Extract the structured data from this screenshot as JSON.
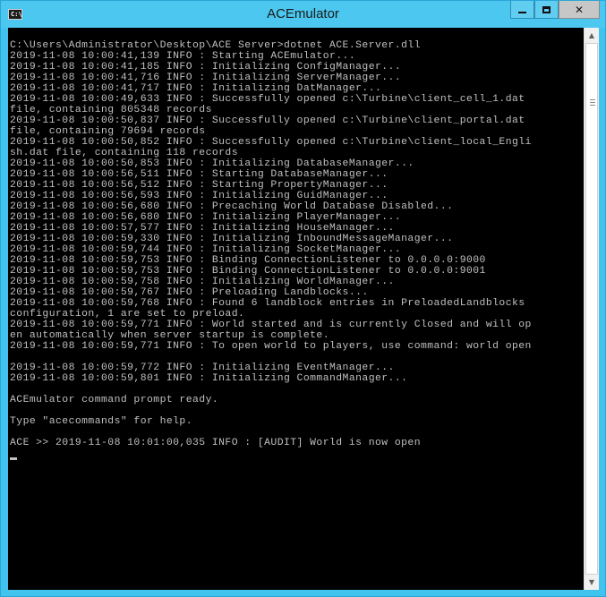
{
  "window": {
    "title": "ACEmulator",
    "minimize_glyph": "minimize-icon",
    "maximize_glyph": "maximize-icon",
    "close_glyph": "✕"
  },
  "console": {
    "lines": [
      "C:\\Users\\Administrator\\Desktop\\ACE Server>dotnet ACE.Server.dll",
      "2019-11-08 10:00:41,139 INFO : Starting ACEmulator...",
      "2019-11-08 10:00:41,185 INFO : Initializing ConfigManager...",
      "2019-11-08 10:00:41,716 INFO : Initializing ServerManager...",
      "2019-11-08 10:00:41,717 INFO : Initializing DatManager...",
      "2019-11-08 10:00:49,633 INFO : Successfully opened c:\\Turbine\\client_cell_1.dat",
      "file, containing 805348 records",
      "2019-11-08 10:00:50,837 INFO : Successfully opened c:\\Turbine\\client_portal.dat",
      "file, containing 79694 records",
      "2019-11-08 10:00:50,852 INFO : Successfully opened c:\\Turbine\\client_local_Engli",
      "sh.dat file, containing 118 records",
      "2019-11-08 10:00:50,853 INFO : Initializing DatabaseManager...",
      "2019-11-08 10:00:56,511 INFO : Starting DatabaseManager...",
      "2019-11-08 10:00:56,512 INFO : Starting PropertyManager...",
      "2019-11-08 10:00:56,593 INFO : Initializing GuidManager...",
      "2019-11-08 10:00:56,680 INFO : Precaching World Database Disabled...",
      "2019-11-08 10:00:56,680 INFO : Initializing PlayerManager...",
      "2019-11-08 10:00:57,577 INFO : Initializing HouseManager...",
      "2019-11-08 10:00:59,330 INFO : Initializing InboundMessageManager...",
      "2019-11-08 10:00:59,744 INFO : Initializing SocketManager...",
      "2019-11-08 10:00:59,753 INFO : Binding ConnectionListener to 0.0.0.0:9000",
      "2019-11-08 10:00:59,753 INFO : Binding ConnectionListener to 0.0.0.0:9001",
      "2019-11-08 10:00:59,758 INFO : Initializing WorldManager...",
      "2019-11-08 10:00:59,767 INFO : Preloading Landblocks...",
      "2019-11-08 10:00:59,768 INFO : Found 6 landblock entries in PreloadedLandblocks",
      "configuration, 1 are set to preload.",
      "2019-11-08 10:00:59,771 INFO : World started and is currently Closed and will op",
      "en automatically when server startup is complete.",
      "2019-11-08 10:00:59,771 INFO : To open world to players, use command: world open",
      "",
      "2019-11-08 10:00:59,772 INFO : Initializing EventManager...",
      "2019-11-08 10:00:59,801 INFO : Initializing CommandManager...",
      "",
      "ACEmulator command prompt ready.",
      "",
      "Type \"acecommands\" for help.",
      "",
      "ACE >> 2019-11-08 10:01:00,035 INFO : [AUDIT] World is now open"
    ]
  }
}
